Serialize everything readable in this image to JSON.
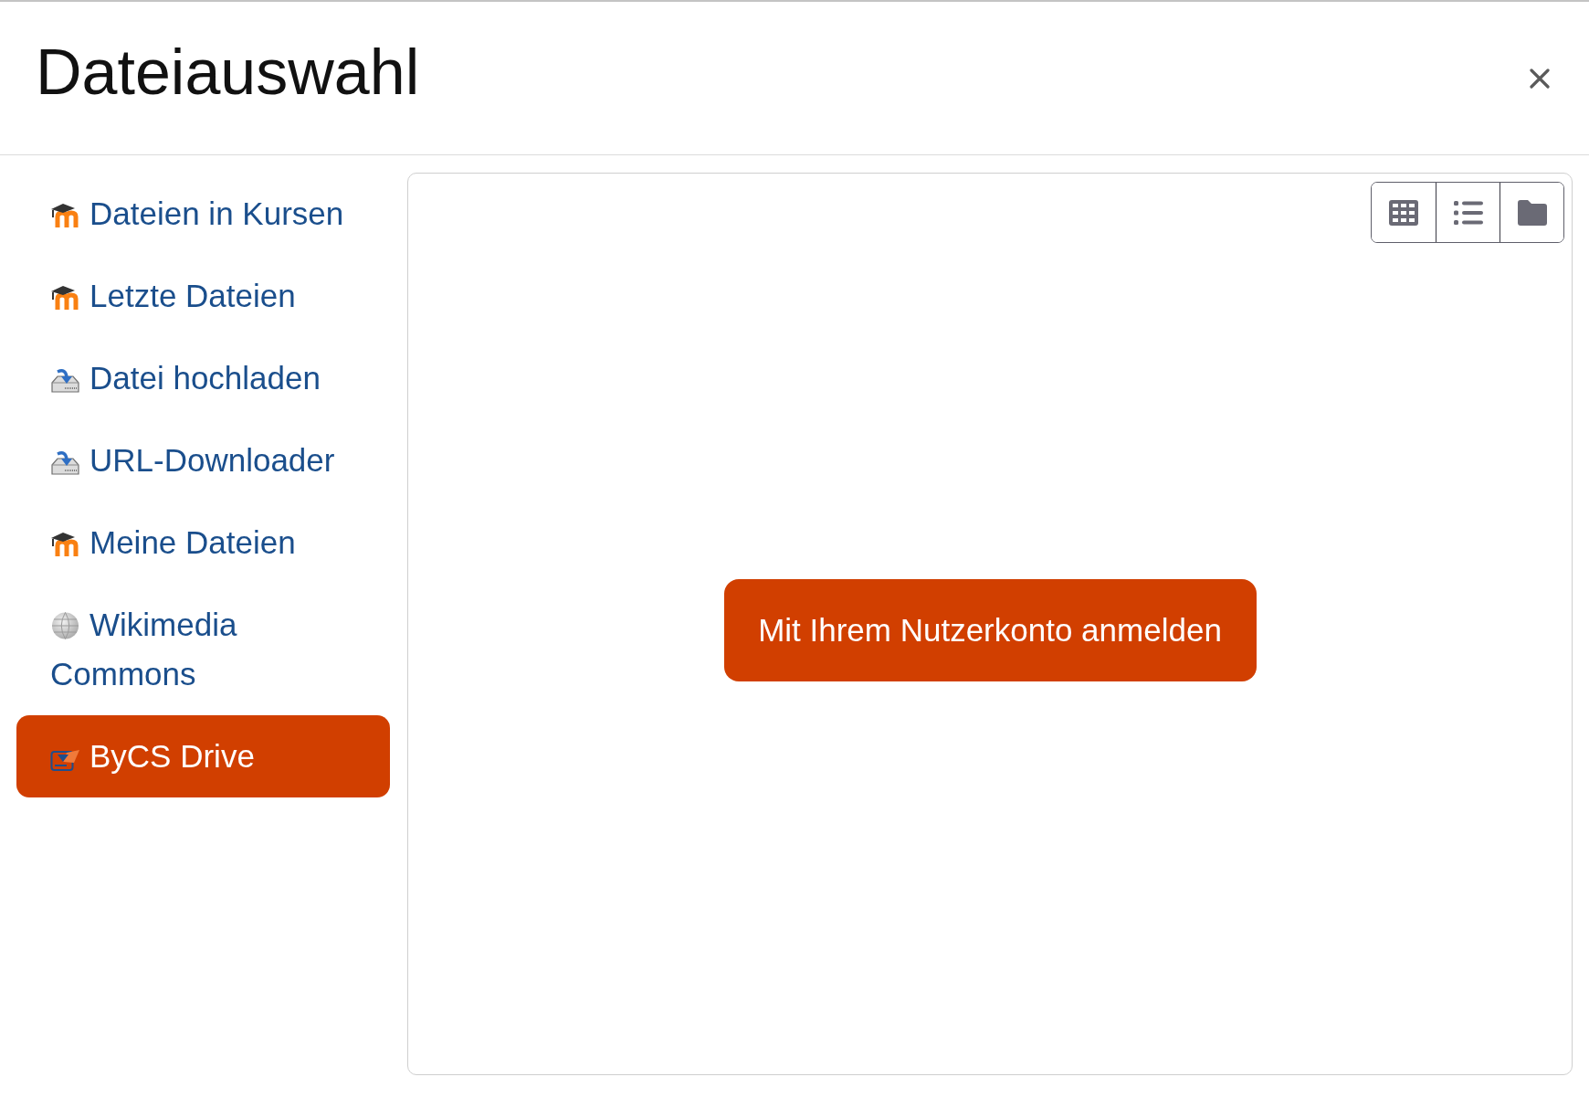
{
  "dialog": {
    "title": "Dateiauswahl"
  },
  "sidebar": {
    "items": [
      {
        "label": "Dateien in Kursen",
        "kind": "cap",
        "selected": false
      },
      {
        "label": "Letzte Dateien",
        "kind": "cap",
        "selected": false
      },
      {
        "label": "Datei hochladen",
        "kind": "tray",
        "selected": false
      },
      {
        "label": "URL-Downloader",
        "kind": "tray",
        "selected": false
      },
      {
        "label": "Meine Dateien",
        "kind": "cap",
        "selected": false
      },
      {
        "label": "Wikimedia Commons",
        "kind": "globe",
        "selected": false
      },
      {
        "label": "ByCS Drive",
        "kind": "drive",
        "selected": true
      }
    ]
  },
  "view_buttons": [
    {
      "kind": "grid",
      "selected": false
    },
    {
      "kind": "list",
      "selected": false
    },
    {
      "kind": "folder",
      "selected": false
    }
  ],
  "login_button": {
    "label": "Mit Ihrem Nutzerkonto anmelden"
  }
}
